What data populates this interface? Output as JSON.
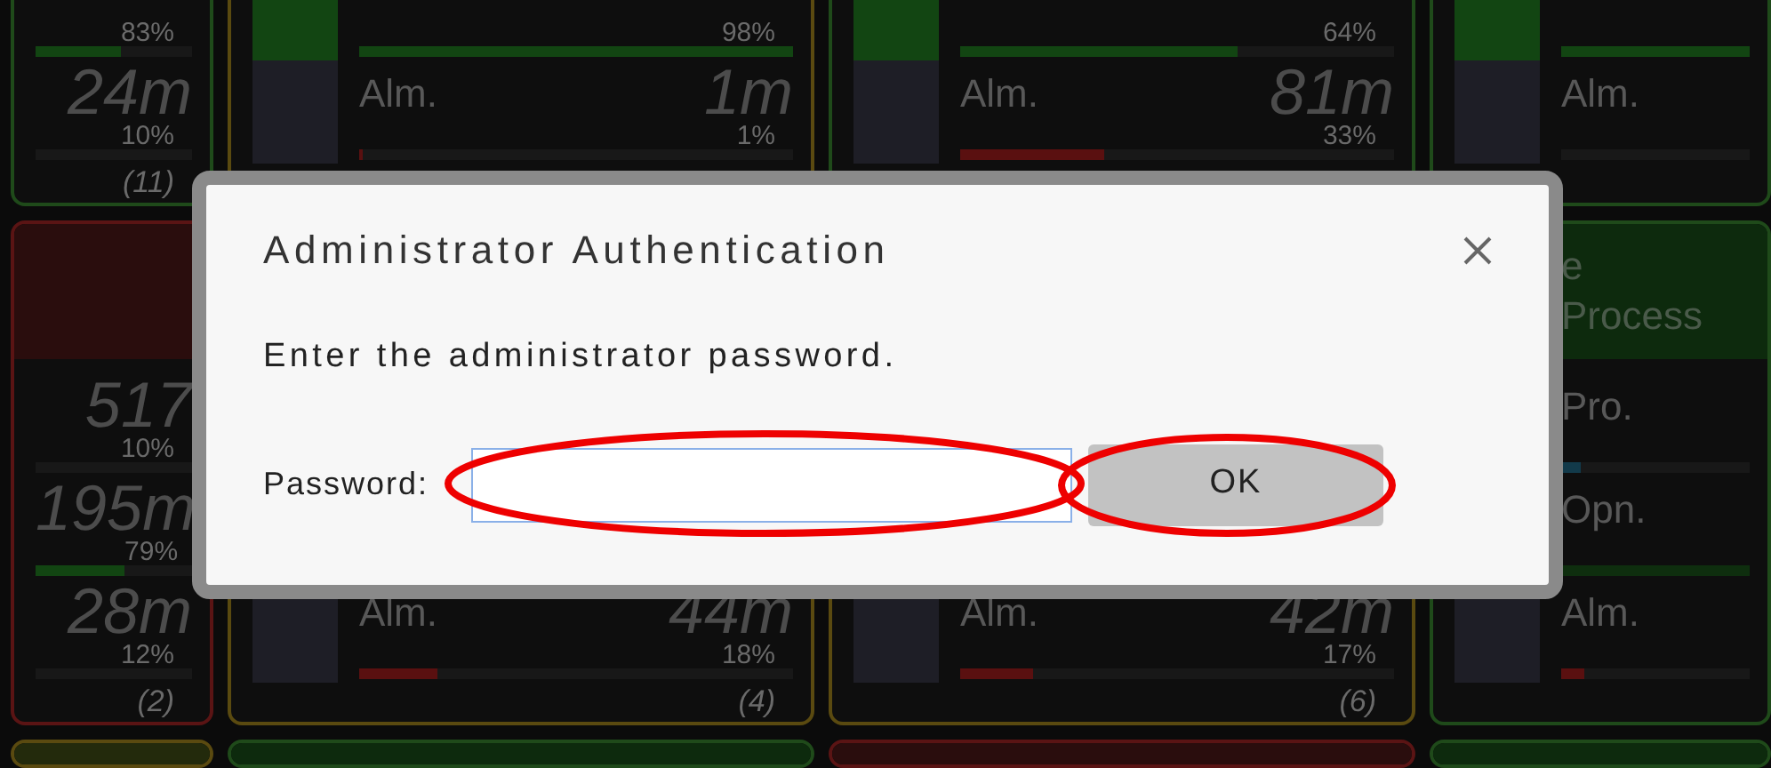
{
  "dashboard": {
    "cards": [
      {
        "kind": "ok",
        "has_header": false,
        "rows": [
          {
            "kind": "ok",
            "percent": "83%",
            "level": 0.55
          },
          {
            "kind": "ok",
            "value": "24m",
            "percent": "10%",
            "level": 0
          }
        ],
        "count": "(11)"
      },
      {
        "kind": "warning",
        "has_header": false,
        "has_blocks": true,
        "rows": [
          {
            "kind": "ok",
            "percent": "98%",
            "level": 1
          },
          {
            "kind": "alarm",
            "label": "Alm.",
            "value": "1m",
            "percent": "1%",
            "level": 0.01
          }
        ]
      },
      {
        "kind": "ok",
        "has_header": false,
        "has_blocks": true,
        "rows": [
          {
            "kind": "ok",
            "percent": "64%",
            "level": 0.64
          },
          {
            "kind": "alarm",
            "label": "Alm.",
            "value": "81m",
            "percent": "33%",
            "level": 0.33
          }
        ]
      },
      {
        "kind": "ok",
        "has_header": false,
        "has_blocks": true,
        "rows": [
          {
            "kind": "ok",
            "level": 1
          },
          {
            "kind": "alarm",
            "label": "Alm.",
            "level": 0
          }
        ]
      },
      {
        "kind": "error",
        "has_header": true,
        "rows": [
          {
            "kind": "ok",
            "value": "517",
            "percent": "10%",
            "level": 0
          },
          {
            "kind": "ok",
            "value": "195m",
            "percent": "79%",
            "level": 0.55
          },
          {
            "kind": "ok",
            "value": "28m",
            "percent": "12%",
            "level": 0
          }
        ],
        "count": "(2)"
      },
      {
        "kind": "warning",
        "has_header": false,
        "has_blocks": true,
        "rows": [
          {
            "kind": "alarm",
            "label": "Alm.",
            "value": "44m",
            "percent": "18%",
            "level": 0.18
          }
        ],
        "count": "(4)"
      },
      {
        "kind": "warning",
        "has_header": false,
        "has_blocks": true,
        "rows": [
          {
            "kind": "alarm",
            "label": "Alm.",
            "value": "42m",
            "percent": "17%",
            "level": 0.17
          }
        ],
        "count": "(6)"
      },
      {
        "kind": "ok",
        "has_header": true,
        "has_blocks": true,
        "header_lines": [
          "e",
          "Process"
        ],
        "rows": [
          {
            "kind": "process",
            "label": "Pro.",
            "level": 0.1
          },
          {
            "kind": "open",
            "label": "Opn.",
            "level": 1
          },
          {
            "kind": "alarm",
            "label": "Alm.",
            "level": 0.12
          }
        ]
      },
      {
        "kind": "warning",
        "has_header": true
      },
      {
        "kind": "ok",
        "has_header": true
      },
      {
        "kind": "error",
        "has_header": true
      },
      {
        "kind": "ok",
        "has_header": true
      }
    ]
  },
  "dialog": {
    "title": "Administrator Authentication",
    "message": "Enter the administrator password.",
    "field": {
      "label": "Password:",
      "highlighted": true
    },
    "button": {
      "label": "OK",
      "highlighted": true
    }
  }
}
